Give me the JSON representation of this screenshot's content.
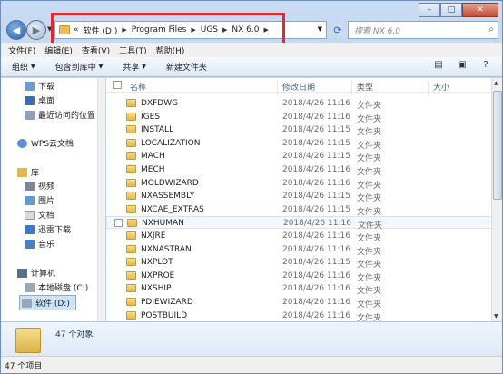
{
  "address": {
    "prefix": "«",
    "crumbs": [
      "软件 (D:)",
      "Program Files",
      "UGS",
      "NX 6.0"
    ],
    "search_placeholder": "搜索 NX 6.0"
  },
  "menu": [
    "文件(F)",
    "编辑(E)",
    "查看(V)",
    "工具(T)",
    "帮助(H)"
  ],
  "toolbar": {
    "organize": "组织",
    "include": "包含到库中",
    "share": "共享",
    "new_folder": "新建文件夹"
  },
  "nav": {
    "favorites": [
      "下载",
      "桌面",
      "最近访问的位置"
    ],
    "wps": "WPS云文档",
    "library": "库",
    "library_items": [
      "视频",
      "图片",
      "文档",
      "迅雷下载",
      "音乐"
    ],
    "computer": "计算机",
    "drives": [
      "本地磁盘 (C:)",
      "软件 (D:)"
    ]
  },
  "columns": {
    "name": "名称",
    "date": "修改日期",
    "type": "类型",
    "size": "大小"
  },
  "files": [
    {
      "name": "DXFDWG",
      "date": "2018/4/26 11:16",
      "type": "文件夹"
    },
    {
      "name": "IGES",
      "date": "2018/4/26 11:16",
      "type": "文件夹"
    },
    {
      "name": "INSTALL",
      "date": "2018/4/26 11:15",
      "type": "文件夹"
    },
    {
      "name": "LOCALIZATION",
      "date": "2018/4/26 11:15",
      "type": "文件夹"
    },
    {
      "name": "MACH",
      "date": "2018/4/26 11:15",
      "type": "文件夹"
    },
    {
      "name": "MECH",
      "date": "2018/4/26 11:16",
      "type": "文件夹"
    },
    {
      "name": "MOLDWIZARD",
      "date": "2018/4/26 11:16",
      "type": "文件夹"
    },
    {
      "name": "NXASSEMBLY",
      "date": "2018/4/26 11:15",
      "type": "文件夹"
    },
    {
      "name": "NXCAE_EXTRAS",
      "date": "2018/4/26 11:15",
      "type": "文件夹"
    },
    {
      "name": "NXHUMAN",
      "date": "2018/4/26 11:16",
      "type": "文件夹"
    },
    {
      "name": "NXJRE",
      "date": "2018/4/26 11:16",
      "type": "文件夹"
    },
    {
      "name": "NXNASTRAN",
      "date": "2018/4/26 11:16",
      "type": "文件夹"
    },
    {
      "name": "NXPLOT",
      "date": "2018/4/26 11:15",
      "type": "文件夹"
    },
    {
      "name": "NXPROE",
      "date": "2018/4/26 11:16",
      "type": "文件夹"
    },
    {
      "name": "NXSHIP",
      "date": "2018/4/26 11:16",
      "type": "文件夹"
    },
    {
      "name": "PDIEWIZARD",
      "date": "2018/4/26 11:16",
      "type": "文件夹"
    },
    {
      "name": "POSTBUILD",
      "date": "2018/4/26 11:16",
      "type": "文件夹"
    }
  ],
  "details": {
    "count": "47 个对象"
  },
  "status": {
    "text": "47 个项目"
  },
  "colors": {
    "highlight": "#e5282d",
    "accent": "#2a5fa6"
  }
}
